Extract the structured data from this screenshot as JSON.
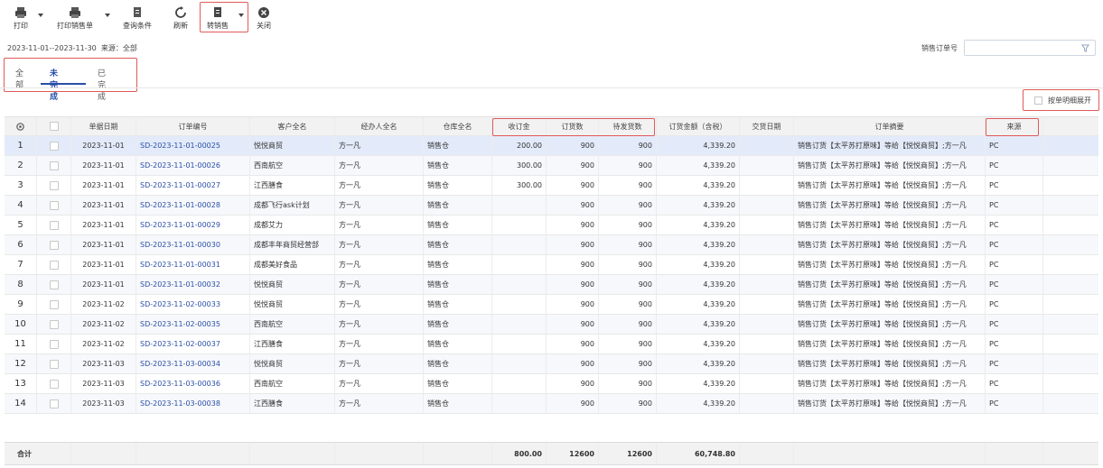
{
  "toolbar": {
    "print": "打印",
    "print_sales": "打印销售单",
    "query": "查询条件",
    "refresh": "刷新",
    "transfer": "转销售",
    "close": "关闭"
  },
  "filter": {
    "date_range": "2023-11-01--2023-11-30",
    "source_text": "来源：全部",
    "order_label": "销售订单号",
    "order_value": ""
  },
  "tabs": [
    "全部",
    "未完成",
    "已完成"
  ],
  "expand_label": "按单明细展开",
  "columns": {
    "date": "单据日期",
    "order_no": "订单编号",
    "customer": "客户全名",
    "handler": "经办人全名",
    "warehouse": "仓库全名",
    "deposit": "收订金",
    "qty": "订货数",
    "pending": "待发货数",
    "amount": "订货金额（含税）",
    "delivery": "交货日期",
    "summary": "订单摘要",
    "source": "来源"
  },
  "rows": [
    {
      "no": "1",
      "date": "2023-11-01",
      "order_no": "SD-2023-11-01-00025",
      "customer": "悦悦商贸",
      "handler": "方一凡",
      "warehouse": "销售仓",
      "deposit": "200.00",
      "qty": "900",
      "pending": "900",
      "amount": "4,339.20",
      "delivery": "",
      "summary": "销售订货【太平苏打原味】等给【悦悦商贸】;方一凡",
      "source": "PC"
    },
    {
      "no": "2",
      "date": "2023-11-01",
      "order_no": "SD-2023-11-01-00026",
      "customer": "西南航空",
      "handler": "方一凡",
      "warehouse": "销售仓",
      "deposit": "300.00",
      "qty": "900",
      "pending": "900",
      "amount": "4,339.20",
      "delivery": "",
      "summary": "销售订货【太平苏打原味】等给【悦悦商贸】;方一凡",
      "source": "PC"
    },
    {
      "no": "3",
      "date": "2023-11-01",
      "order_no": "SD-2023-11-01-00027",
      "customer": "江西膳食",
      "handler": "方一凡",
      "warehouse": "销售仓",
      "deposit": "300.00",
      "qty": "900",
      "pending": "900",
      "amount": "4,339.20",
      "delivery": "",
      "summary": "销售订货【太平苏打原味】等给【悦悦商贸】;方一凡",
      "source": "PC"
    },
    {
      "no": "4",
      "date": "2023-11-01",
      "order_no": "SD-2023-11-01-00028",
      "customer": "成都飞行ask计划",
      "handler": "方一凡",
      "warehouse": "销售仓",
      "deposit": "",
      "qty": "900",
      "pending": "900",
      "amount": "4,339.20",
      "delivery": "",
      "summary": "销售订货【太平苏打原味】等给【悦悦商贸】;方一凡",
      "source": "PC"
    },
    {
      "no": "5",
      "date": "2023-11-01",
      "order_no": "SD-2023-11-01-00029",
      "customer": "成都艾力",
      "handler": "方一凡",
      "warehouse": "销售仓",
      "deposit": "",
      "qty": "900",
      "pending": "900",
      "amount": "4,339.20",
      "delivery": "",
      "summary": "销售订货【太平苏打原味】等给【悦悦商贸】;方一凡",
      "source": "PC"
    },
    {
      "no": "6",
      "date": "2023-11-01",
      "order_no": "SD-2023-11-01-00030",
      "customer": "成都丰年商贸经营部",
      "handler": "方一凡",
      "warehouse": "销售仓",
      "deposit": "",
      "qty": "900",
      "pending": "900",
      "amount": "4,339.20",
      "delivery": "",
      "summary": "销售订货【太平苏打原味】等给【悦悦商贸】;方一凡",
      "source": "PC"
    },
    {
      "no": "7",
      "date": "2023-11-01",
      "order_no": "SD-2023-11-01-00031",
      "customer": "成都美好食品",
      "handler": "方一凡",
      "warehouse": "销售仓",
      "deposit": "",
      "qty": "900",
      "pending": "900",
      "amount": "4,339.20",
      "delivery": "",
      "summary": "销售订货【太平苏打原味】等给【悦悦商贸】;方一凡",
      "source": "PC"
    },
    {
      "no": "8",
      "date": "2023-11-01",
      "order_no": "SD-2023-11-01-00032",
      "customer": "悦悦商贸",
      "handler": "方一凡",
      "warehouse": "销售仓",
      "deposit": "",
      "qty": "900",
      "pending": "900",
      "amount": "4,339.20",
      "delivery": "",
      "summary": "销售订货【太平苏打原味】等给【悦悦商贸】;方一凡",
      "source": "PC"
    },
    {
      "no": "9",
      "date": "2023-11-02",
      "order_no": "SD-2023-11-02-00033",
      "customer": "悦悦商贸",
      "handler": "方一凡",
      "warehouse": "销售仓",
      "deposit": "",
      "qty": "900",
      "pending": "900",
      "amount": "4,339.20",
      "delivery": "",
      "summary": "销售订货【太平苏打原味】等给【悦悦商贸】;方一凡",
      "source": "PC"
    },
    {
      "no": "10",
      "date": "2023-11-02",
      "order_no": "SD-2023-11-02-00035",
      "customer": "西南航空",
      "handler": "方一凡",
      "warehouse": "销售仓",
      "deposit": "",
      "qty": "900",
      "pending": "900",
      "amount": "4,339.20",
      "delivery": "",
      "summary": "销售订货【太平苏打原味】等给【悦悦商贸】;方一凡",
      "source": "PC"
    },
    {
      "no": "11",
      "date": "2023-11-02",
      "order_no": "SD-2023-11-02-00037",
      "customer": "江西膳食",
      "handler": "方一凡",
      "warehouse": "销售仓",
      "deposit": "",
      "qty": "900",
      "pending": "900",
      "amount": "4,339.20",
      "delivery": "",
      "summary": "销售订货【太平苏打原味】等给【悦悦商贸】;方一凡",
      "source": "PC"
    },
    {
      "no": "12",
      "date": "2023-11-03",
      "order_no": "SD-2023-11-03-00034",
      "customer": "悦悦商贸",
      "handler": "方一凡",
      "warehouse": "销售仓",
      "deposit": "",
      "qty": "900",
      "pending": "900",
      "amount": "4,339.20",
      "delivery": "",
      "summary": "销售订货【太平苏打原味】等给【悦悦商贸】;方一凡",
      "source": "PC"
    },
    {
      "no": "13",
      "date": "2023-11-03",
      "order_no": "SD-2023-11-03-00036",
      "customer": "西南航空",
      "handler": "方一凡",
      "warehouse": "销售仓",
      "deposit": "",
      "qty": "900",
      "pending": "900",
      "amount": "4,339.20",
      "delivery": "",
      "summary": "销售订货【太平苏打原味】等给【悦悦商贸】;方一凡",
      "source": "PC"
    },
    {
      "no": "14",
      "date": "2023-11-03",
      "order_no": "SD-2023-11-03-00038",
      "customer": "江西膳食",
      "handler": "方一凡",
      "warehouse": "销售仓",
      "deposit": "",
      "qty": "900",
      "pending": "900",
      "amount": "4,339.20",
      "delivery": "",
      "summary": "销售订货【太平苏打原味】等给【悦悦商贸】;方一凡",
      "source": "PC"
    }
  ],
  "totals": {
    "label": "合计",
    "deposit": "800.00",
    "qty": "12600",
    "pending": "12600",
    "amount": "60,748.80"
  },
  "colors": {
    "accent": "#2b4fa8",
    "highlight": "#e05a5a",
    "selected_row": "#e3ebfa"
  }
}
